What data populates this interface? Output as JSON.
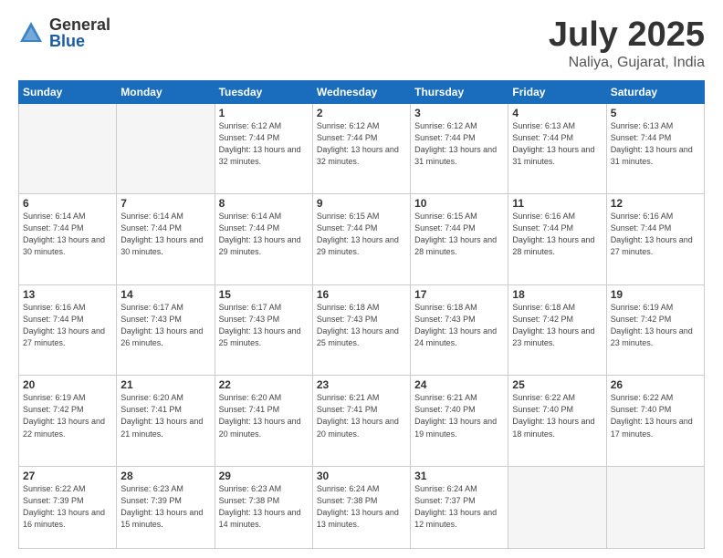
{
  "logo": {
    "general": "General",
    "blue": "Blue"
  },
  "header": {
    "month": "July 2025",
    "location": "Naliya, Gujarat, India"
  },
  "weekdays": [
    "Sunday",
    "Monday",
    "Tuesday",
    "Wednesday",
    "Thursday",
    "Friday",
    "Saturday"
  ],
  "weeks": [
    [
      {
        "day": "",
        "info": ""
      },
      {
        "day": "",
        "info": ""
      },
      {
        "day": "1",
        "info": "Sunrise: 6:12 AM\nSunset: 7:44 PM\nDaylight: 13 hours and 32 minutes."
      },
      {
        "day": "2",
        "info": "Sunrise: 6:12 AM\nSunset: 7:44 PM\nDaylight: 13 hours and 32 minutes."
      },
      {
        "day": "3",
        "info": "Sunrise: 6:12 AM\nSunset: 7:44 PM\nDaylight: 13 hours and 31 minutes."
      },
      {
        "day": "4",
        "info": "Sunrise: 6:13 AM\nSunset: 7:44 PM\nDaylight: 13 hours and 31 minutes."
      },
      {
        "day": "5",
        "info": "Sunrise: 6:13 AM\nSunset: 7:44 PM\nDaylight: 13 hours and 31 minutes."
      }
    ],
    [
      {
        "day": "6",
        "info": "Sunrise: 6:14 AM\nSunset: 7:44 PM\nDaylight: 13 hours and 30 minutes."
      },
      {
        "day": "7",
        "info": "Sunrise: 6:14 AM\nSunset: 7:44 PM\nDaylight: 13 hours and 30 minutes."
      },
      {
        "day": "8",
        "info": "Sunrise: 6:14 AM\nSunset: 7:44 PM\nDaylight: 13 hours and 29 minutes."
      },
      {
        "day": "9",
        "info": "Sunrise: 6:15 AM\nSunset: 7:44 PM\nDaylight: 13 hours and 29 minutes."
      },
      {
        "day": "10",
        "info": "Sunrise: 6:15 AM\nSunset: 7:44 PM\nDaylight: 13 hours and 28 minutes."
      },
      {
        "day": "11",
        "info": "Sunrise: 6:16 AM\nSunset: 7:44 PM\nDaylight: 13 hours and 28 minutes."
      },
      {
        "day": "12",
        "info": "Sunrise: 6:16 AM\nSunset: 7:44 PM\nDaylight: 13 hours and 27 minutes."
      }
    ],
    [
      {
        "day": "13",
        "info": "Sunrise: 6:16 AM\nSunset: 7:44 PM\nDaylight: 13 hours and 27 minutes."
      },
      {
        "day": "14",
        "info": "Sunrise: 6:17 AM\nSunset: 7:43 PM\nDaylight: 13 hours and 26 minutes."
      },
      {
        "day": "15",
        "info": "Sunrise: 6:17 AM\nSunset: 7:43 PM\nDaylight: 13 hours and 25 minutes."
      },
      {
        "day": "16",
        "info": "Sunrise: 6:18 AM\nSunset: 7:43 PM\nDaylight: 13 hours and 25 minutes."
      },
      {
        "day": "17",
        "info": "Sunrise: 6:18 AM\nSunset: 7:43 PM\nDaylight: 13 hours and 24 minutes."
      },
      {
        "day": "18",
        "info": "Sunrise: 6:18 AM\nSunset: 7:42 PM\nDaylight: 13 hours and 23 minutes."
      },
      {
        "day": "19",
        "info": "Sunrise: 6:19 AM\nSunset: 7:42 PM\nDaylight: 13 hours and 23 minutes."
      }
    ],
    [
      {
        "day": "20",
        "info": "Sunrise: 6:19 AM\nSunset: 7:42 PM\nDaylight: 13 hours and 22 minutes."
      },
      {
        "day": "21",
        "info": "Sunrise: 6:20 AM\nSunset: 7:41 PM\nDaylight: 13 hours and 21 minutes."
      },
      {
        "day": "22",
        "info": "Sunrise: 6:20 AM\nSunset: 7:41 PM\nDaylight: 13 hours and 20 minutes."
      },
      {
        "day": "23",
        "info": "Sunrise: 6:21 AM\nSunset: 7:41 PM\nDaylight: 13 hours and 20 minutes."
      },
      {
        "day": "24",
        "info": "Sunrise: 6:21 AM\nSunset: 7:40 PM\nDaylight: 13 hours and 19 minutes."
      },
      {
        "day": "25",
        "info": "Sunrise: 6:22 AM\nSunset: 7:40 PM\nDaylight: 13 hours and 18 minutes."
      },
      {
        "day": "26",
        "info": "Sunrise: 6:22 AM\nSunset: 7:40 PM\nDaylight: 13 hours and 17 minutes."
      }
    ],
    [
      {
        "day": "27",
        "info": "Sunrise: 6:22 AM\nSunset: 7:39 PM\nDaylight: 13 hours and 16 minutes."
      },
      {
        "day": "28",
        "info": "Sunrise: 6:23 AM\nSunset: 7:39 PM\nDaylight: 13 hours and 15 minutes."
      },
      {
        "day": "29",
        "info": "Sunrise: 6:23 AM\nSunset: 7:38 PM\nDaylight: 13 hours and 14 minutes."
      },
      {
        "day": "30",
        "info": "Sunrise: 6:24 AM\nSunset: 7:38 PM\nDaylight: 13 hours and 13 minutes."
      },
      {
        "day": "31",
        "info": "Sunrise: 6:24 AM\nSunset: 7:37 PM\nDaylight: 13 hours and 12 minutes."
      },
      {
        "day": "",
        "info": ""
      },
      {
        "day": "",
        "info": ""
      }
    ]
  ]
}
